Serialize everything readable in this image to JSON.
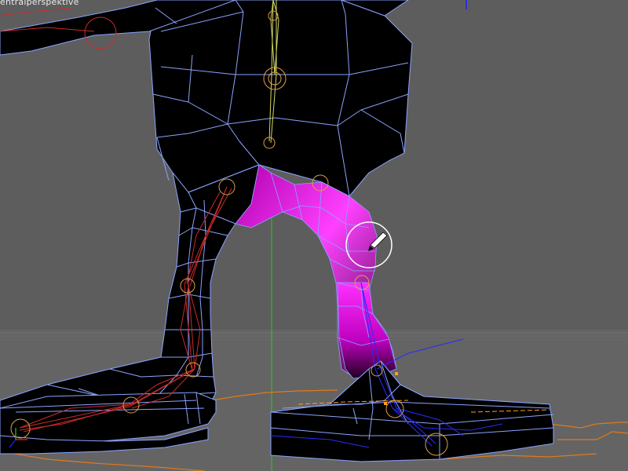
{
  "viewport": {
    "label": "entralperspektive",
    "background_color": "#5d5d5d",
    "floor_color": "#646464",
    "mesh_fill_color": "#000000",
    "wire_color": "#8aa3ff",
    "selected_fill_color": "#ff00ff",
    "bone_color": "#cc2a2a",
    "spine_bone_color": "#d4d860",
    "joint_color": "#e0a040",
    "axis_x_color": "#ff2020",
    "axis_y_color": "#20d020",
    "axis_z_color": "#2020ff",
    "cursor_tool": "paint-brush"
  }
}
